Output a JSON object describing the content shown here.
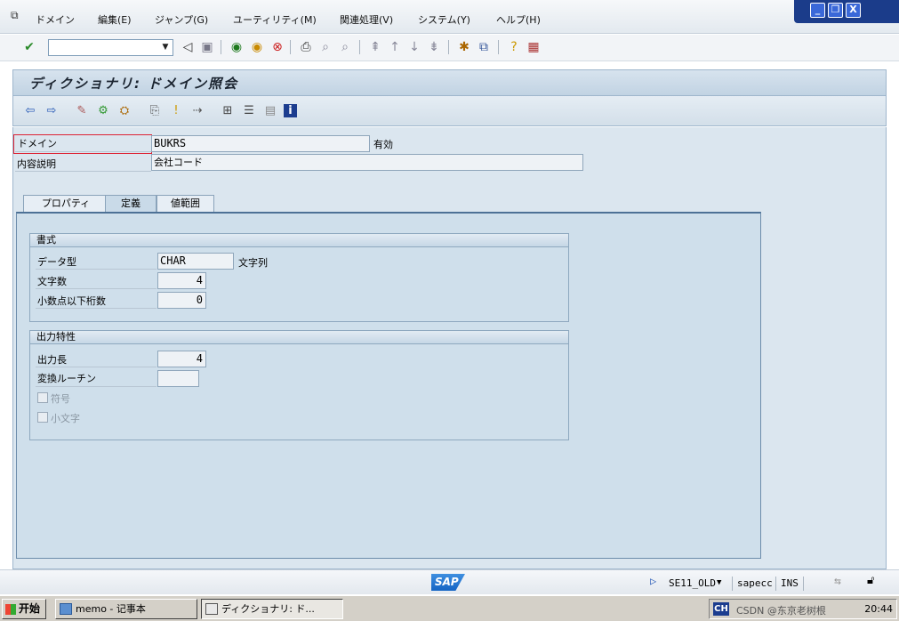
{
  "menu": {
    "items": [
      "ドメイン",
      "編集(E)",
      "ジャンプ(G)",
      "ユーティリティ(M)",
      "関連処理(V)",
      "システム(Y)",
      "ヘルプ(H)"
    ]
  },
  "window_controls": {
    "minimize": "_",
    "restore": "❐",
    "close": "X"
  },
  "toolbar": {
    "command_value": ""
  },
  "title": "ディクショナリ: ドメイン照会",
  "header": {
    "domain_label": "ドメイン",
    "domain_value": "BUKRS",
    "domain_status": "有効",
    "description_label": "内容説明",
    "description_value": "会社コード"
  },
  "tabs": [
    {
      "label": "プロパティ",
      "active": false
    },
    {
      "label": "定義",
      "active": true
    },
    {
      "label": "値範囲",
      "active": false
    }
  ],
  "format_group": {
    "title": "書式",
    "datatype_label": "データ型",
    "datatype_value": "CHAR",
    "datatype_desc": "文字列",
    "length_label": "文字数",
    "length_value": "4",
    "decimals_label": "小数点以下桁数",
    "decimals_value": "0"
  },
  "output_group": {
    "title": "出力特性",
    "outlen_label": "出力長",
    "outlen_value": "4",
    "convexit_label": "変換ルーチン",
    "convexit_value": "",
    "sign_label": "符号",
    "lowercase_label": "小文字"
  },
  "status": {
    "transaction": "SE11_OLD",
    "system": "sapecc",
    "mode": "INS",
    "logo": "SAP"
  },
  "taskbar": {
    "start": "开始",
    "tasks": [
      "memo - 记事本",
      "ディクショナリ: ド..."
    ],
    "tray_lang": "CH",
    "watermark": "CSDN @东京老树根",
    "clock": "20:44"
  },
  "colors": {
    "accent": "#1b3c8a",
    "panel": "#cfdfeb",
    "title_bg": "#c1d3e3"
  }
}
